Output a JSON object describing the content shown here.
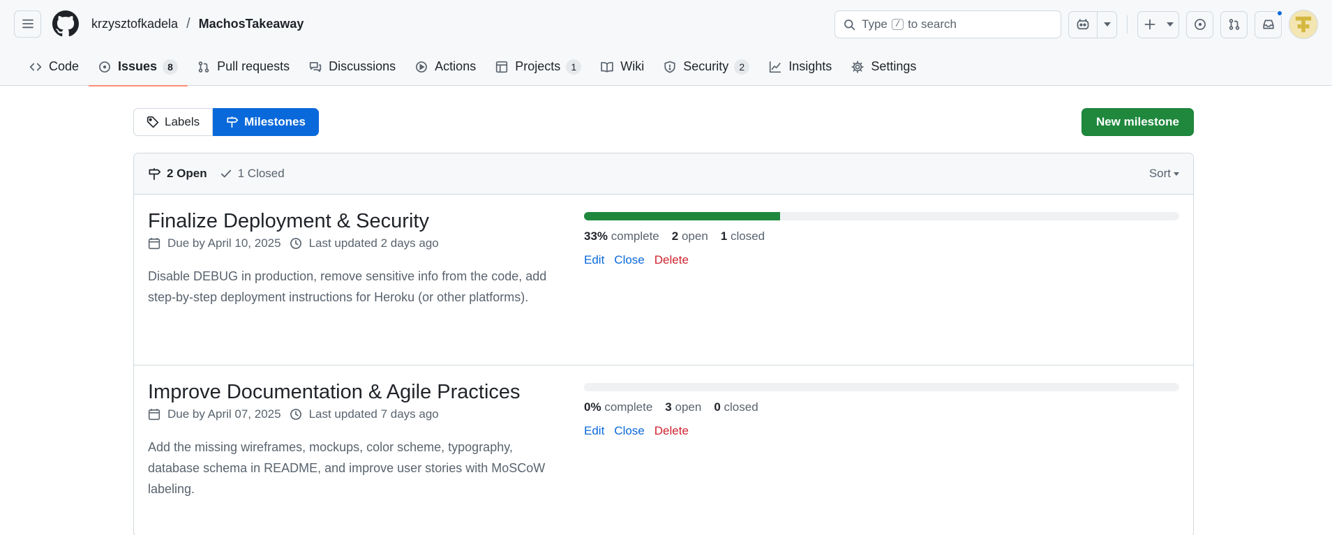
{
  "header": {
    "owner": "krzysztofkadela",
    "separator": "/",
    "repo": "MachosTakeaway",
    "search": {
      "prefix": "Type",
      "key": "/",
      "suffix": "to search"
    }
  },
  "tabs": [
    {
      "label": "Code",
      "icon": "code-icon"
    },
    {
      "label": "Issues",
      "icon": "issue-icon",
      "count": "8",
      "active": true
    },
    {
      "label": "Pull requests",
      "icon": "pull-request-icon"
    },
    {
      "label": "Discussions",
      "icon": "discussions-icon"
    },
    {
      "label": "Actions",
      "icon": "actions-icon"
    },
    {
      "label": "Projects",
      "icon": "projects-icon",
      "count": "1"
    },
    {
      "label": "Wiki",
      "icon": "wiki-icon"
    },
    {
      "label": "Security",
      "icon": "shield-icon",
      "count": "2"
    },
    {
      "label": "Insights",
      "icon": "graph-icon"
    },
    {
      "label": "Settings",
      "icon": "gear-icon"
    }
  ],
  "toolbar": {
    "labels": "Labels",
    "milestones": "Milestones",
    "new_milestone": "New milestone"
  },
  "list": {
    "open": "2 Open",
    "closed": "1 Closed",
    "sort": "Sort"
  },
  "milestones": [
    {
      "title": "Finalize Deployment & Security",
      "due": "Due by April 10, 2025",
      "updated": "Last updated 2 days ago",
      "description": "Disable DEBUG in production, remove sensitive info from the code, add step-by-step deployment instructions for Heroku (or other platforms).",
      "percent_complete": 33,
      "percent_label": "33%",
      "complete_word": "complete",
      "open_count": "2",
      "open_word": "open",
      "closed_count": "1",
      "closed_word": "closed",
      "edit": "Edit",
      "close": "Close",
      "delete": "Delete"
    },
    {
      "title": "Improve Documentation & Agile Practices",
      "due": "Due by April 07, 2025",
      "updated": "Last updated 7 days ago",
      "description": "Add the missing wireframes, mockups, color scheme, typography, database schema in README, and improve user stories with MoSCoW labeling.",
      "percent_complete": 0,
      "percent_label": "0%",
      "complete_word": "complete",
      "open_count": "3",
      "open_word": "open",
      "closed_count": "0",
      "closed_word": "closed",
      "edit": "Edit",
      "close": "Close",
      "delete": "Delete"
    }
  ],
  "colors": {
    "accent": "#0969da",
    "primary_button": "#1f883d",
    "progress_fill": "#1f883d",
    "danger": "#cf222e",
    "active_tab_underline": "#fd8c73"
  }
}
